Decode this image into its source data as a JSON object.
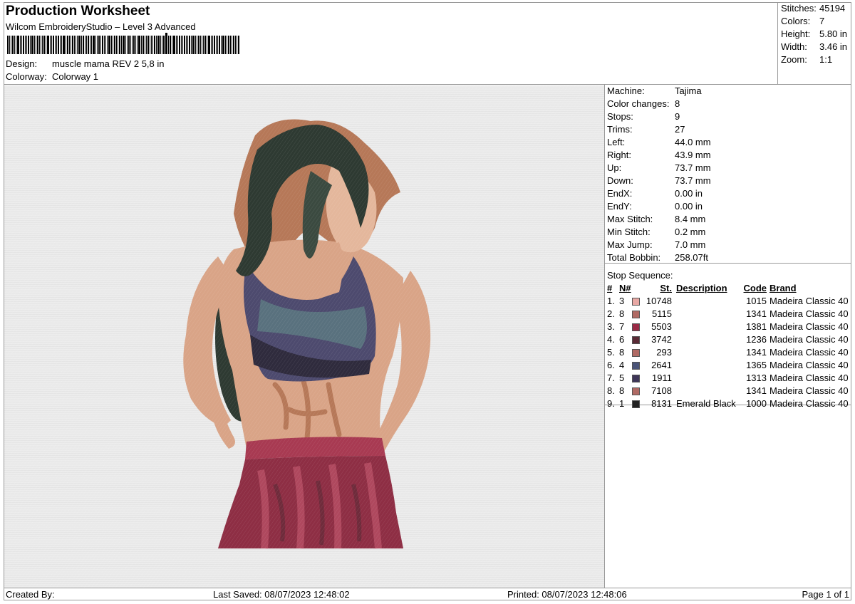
{
  "header": {
    "title": "Production Worksheet",
    "software": "Wilcom EmbroideryStudio – Level 3 Advanced",
    "design_label": "Design:",
    "design_value": "muscle mama REV 2 5,8 in",
    "colorway_label": "Colorway:",
    "colorway_value": "Colorway 1"
  },
  "stats": [
    {
      "k": "Stitches:",
      "v": "45194"
    },
    {
      "k": "Colors:",
      "v": "7"
    },
    {
      "k": "Height:",
      "v": "5.80 in"
    },
    {
      "k": "Width:",
      "v": "3.46 in"
    },
    {
      "k": "Zoom:",
      "v": "1:1"
    }
  ],
  "machine_info": [
    {
      "k": "Machine:",
      "v": "Tajima"
    },
    {
      "k": "Color changes:",
      "v": "8"
    },
    {
      "k": "Stops:",
      "v": "9"
    },
    {
      "k": "Trims:",
      "v": "27"
    },
    {
      "k": "Left:",
      "v": "44.0 mm"
    },
    {
      "k": "Right:",
      "v": "43.9 mm"
    },
    {
      "k": "Up:",
      "v": "73.7 mm"
    },
    {
      "k": "Down:",
      "v": "73.7 mm"
    },
    {
      "k": "EndX:",
      "v": "0.00 in"
    },
    {
      "k": "EndY:",
      "v": "0.00 in"
    },
    {
      "k": "Max Stitch:",
      "v": "8.4 mm"
    },
    {
      "k": "Min Stitch:",
      "v": "0.2 mm"
    },
    {
      "k": "Max Jump:",
      "v": "7.0 mm"
    },
    {
      "k": "Total Bobbin:",
      "v": "258.07ft"
    }
  ],
  "stop_sequence": {
    "title": "Stop Sequence:",
    "headers": {
      "num": "#",
      "n": "N#",
      "st": "St.",
      "desc": "Description",
      "code": "Code",
      "brand": "Brand"
    },
    "rows": [
      {
        "num": "1.",
        "n": "3",
        "color": "#e8a8a4",
        "st": "10748",
        "desc": "",
        "code": "1015",
        "brand": "Madeira Classic 40"
      },
      {
        "num": "2.",
        "n": "8",
        "color": "#b06a64",
        "st": "5115",
        "desc": "",
        "code": "1341",
        "brand": "Madeira Classic 40"
      },
      {
        "num": "3.",
        "n": "7",
        "color": "#9a2a45",
        "st": "5503",
        "desc": "",
        "code": "1381",
        "brand": "Madeira Classic 40"
      },
      {
        "num": "4.",
        "n": "6",
        "color": "#5a2a35",
        "st": "3742",
        "desc": "",
        "code": "1236",
        "brand": "Madeira Classic 40"
      },
      {
        "num": "5.",
        "n": "8",
        "color": "#b06a64",
        "st": "293",
        "desc": "",
        "code": "1341",
        "brand": "Madeira Classic 40"
      },
      {
        "num": "6.",
        "n": "4",
        "color": "#4a5478",
        "st": "2641",
        "desc": "",
        "code": "1365",
        "brand": "Madeira Classic 40"
      },
      {
        "num": "7.",
        "n": "5",
        "color": "#3e3658",
        "st": "1911",
        "desc": "",
        "code": "1313",
        "brand": "Madeira Classic 40"
      },
      {
        "num": "8.",
        "n": "8",
        "color": "#b06a64",
        "st": "7108",
        "desc": "",
        "code": "1341",
        "brand": "Madeira Classic 40"
      },
      {
        "num": "9.",
        "n": "1",
        "color": "#222222",
        "st": "8131",
        "desc": "Emerald Black",
        "code": "1000",
        "brand": "Madeira Classic 40"
      }
    ]
  },
  "footer": {
    "created_by": "Created By:",
    "last_saved": "Last Saved: 08/07/2023 12:48:02",
    "printed": "Printed: 08/07/2023 12:48:06",
    "page": "Page 1 of 1"
  }
}
